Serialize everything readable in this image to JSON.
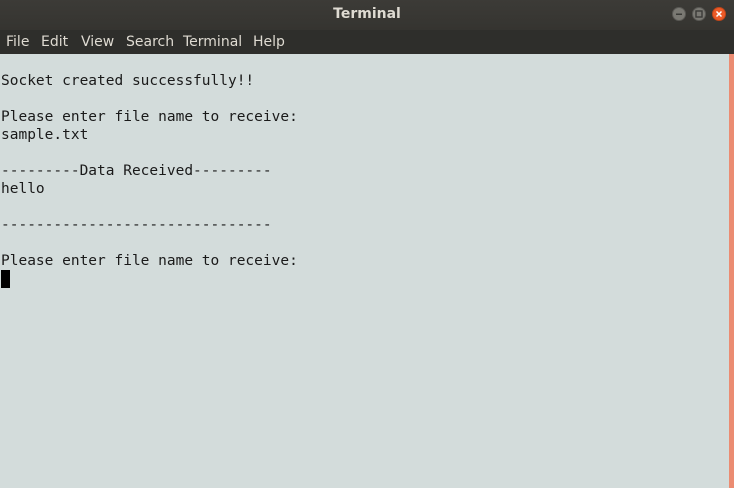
{
  "window": {
    "title": "Terminal"
  },
  "menu": {
    "items": [
      "File",
      "Edit",
      "View",
      "Search",
      "Terminal",
      "Help"
    ]
  },
  "terminal": {
    "lines": [
      "",
      "Socket created successfully!!",
      "",
      "Please enter file name to receive:",
      "sample.txt",
      "",
      "---------Data Received---------",
      "hello",
      "",
      "-------------------------------",
      "",
      "Please enter file name to receive:"
    ]
  },
  "colors": {
    "terminal_bg": "#d3dcdb",
    "titlebar_bg": "#3c3b37",
    "scrollbar": "#eb8c72",
    "close_button": "#ec5a27"
  },
  "icons": {
    "minimize": "minimize-icon",
    "maximize": "maximize-icon",
    "close": "close-icon"
  }
}
